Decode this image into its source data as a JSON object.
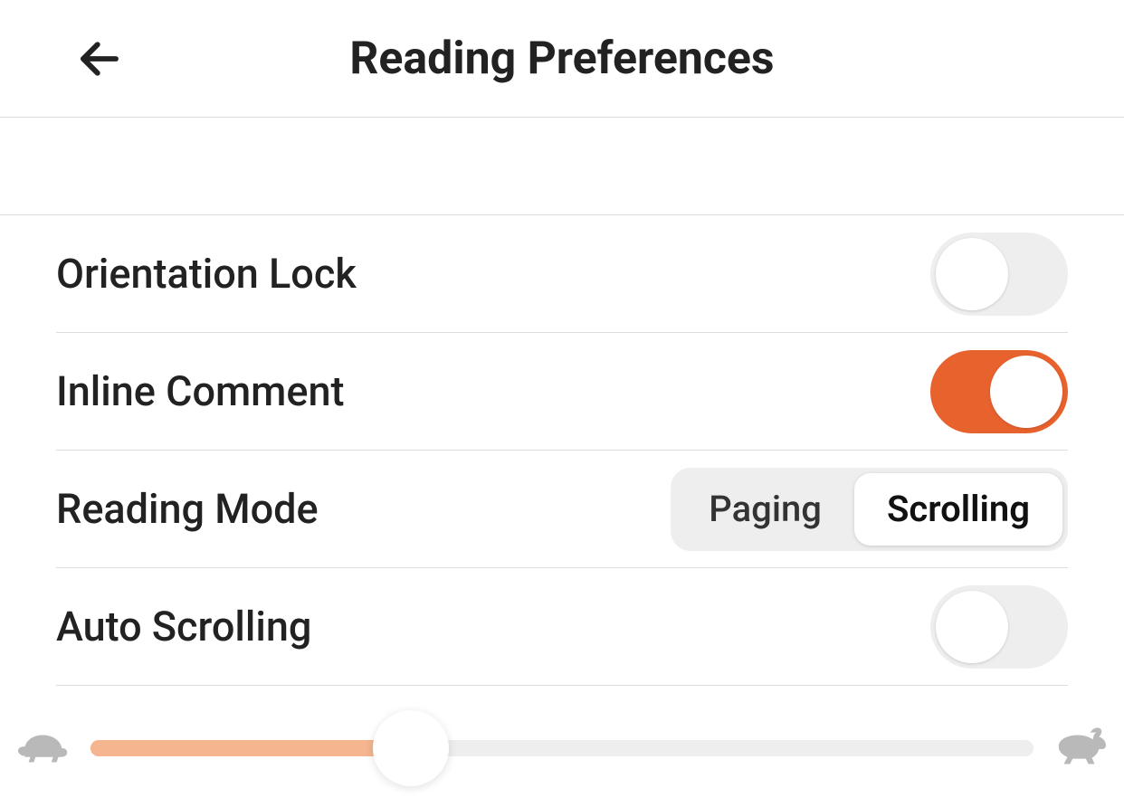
{
  "header": {
    "title": "Reading Preferences"
  },
  "settings": {
    "orientation_lock": {
      "label": "Orientation Lock",
      "value": false
    },
    "inline_comment": {
      "label": "Inline Comment",
      "value": true
    },
    "reading_mode": {
      "label": "Reading Mode",
      "options": [
        "Paging",
        "Scrolling"
      ],
      "selected": "Scrolling"
    },
    "auto_scrolling": {
      "label": "Auto Scrolling",
      "value": false
    },
    "speed_slider": {
      "value_percent": 34,
      "slow_icon": "turtle-icon",
      "fast_icon": "rabbit-icon"
    }
  },
  "colors": {
    "accent": "#e8622e",
    "accent_light": "#f4b58f",
    "neutral_bg": "#eeeeee"
  }
}
